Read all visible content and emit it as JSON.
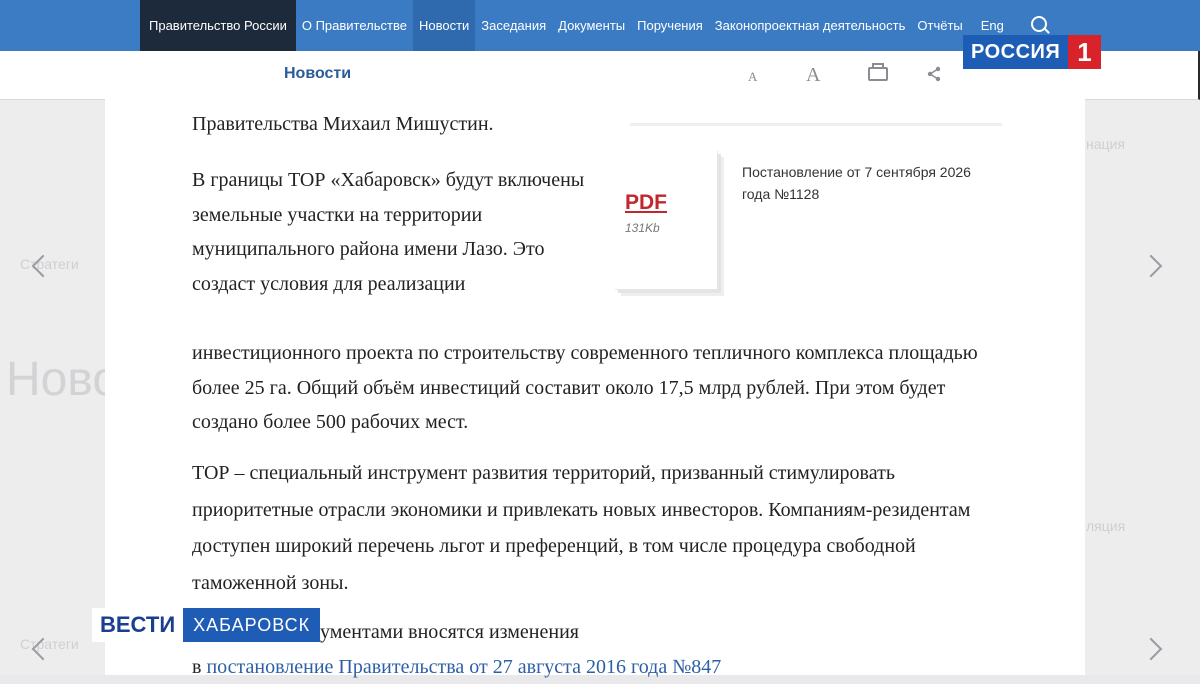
{
  "nav": {
    "items": [
      "Правительство России",
      "О Правительстве",
      "Новости",
      "Заседания",
      "Документы",
      "Поручения",
      "Законопроектная деятельность",
      "Отчёты",
      "Eng"
    ]
  },
  "subheader": {
    "title": "Новости",
    "font_small": "A",
    "font_large": "A"
  },
  "background": {
    "big_word": "Ново",
    "left_label": "Стратеги",
    "right_label": "нация",
    "right_label2": "ляция"
  },
  "article": {
    "p1": "Правительства Михаил Мишустин.",
    "p2": "В границы ТОР «Хабаровск» будут включены земельные участки на территории муниципального района имени Лазо. Это создаст условия для реализации",
    "p3": "инвестиционного проекта по строительству современного тепличного комплекса площадью более 25 га. Общий объём инвестиций составит около 17,5 млрд рублей. При этом будет создано более 500 рабочих мест.",
    "p4": "ТОР – специальный инструмент развития территорий, призванный стимулировать приоритетные отрасли экономики и привлекать новых инвесторов. Компаниям-резидентам доступен широкий перечень льгот и преференций, в том числе процедура свободной таможенной зоны.",
    "p5_start": "ми документами вносятся изменения",
    "p5_prefix": "в ",
    "p5_link": "постановление Правительства от 27 августа 2016 года №847"
  },
  "document": {
    "pdf_label": "PDF",
    "size": "131Kb",
    "title": "Постановление от 7 сентября 2026 года №1128"
  },
  "logo": {
    "text": "РОССИЯ",
    "number": "1"
  },
  "lower_third": {
    "program": "ВЕСТИ",
    "region": "ХАБАРОВСК"
  },
  "colors": {
    "nav_bg": "#3a7bc3",
    "brand_bg": "#1d2a3c",
    "title": "#2b5b98",
    "pdf": "#c1272d",
    "link": "#2c5fa4"
  }
}
